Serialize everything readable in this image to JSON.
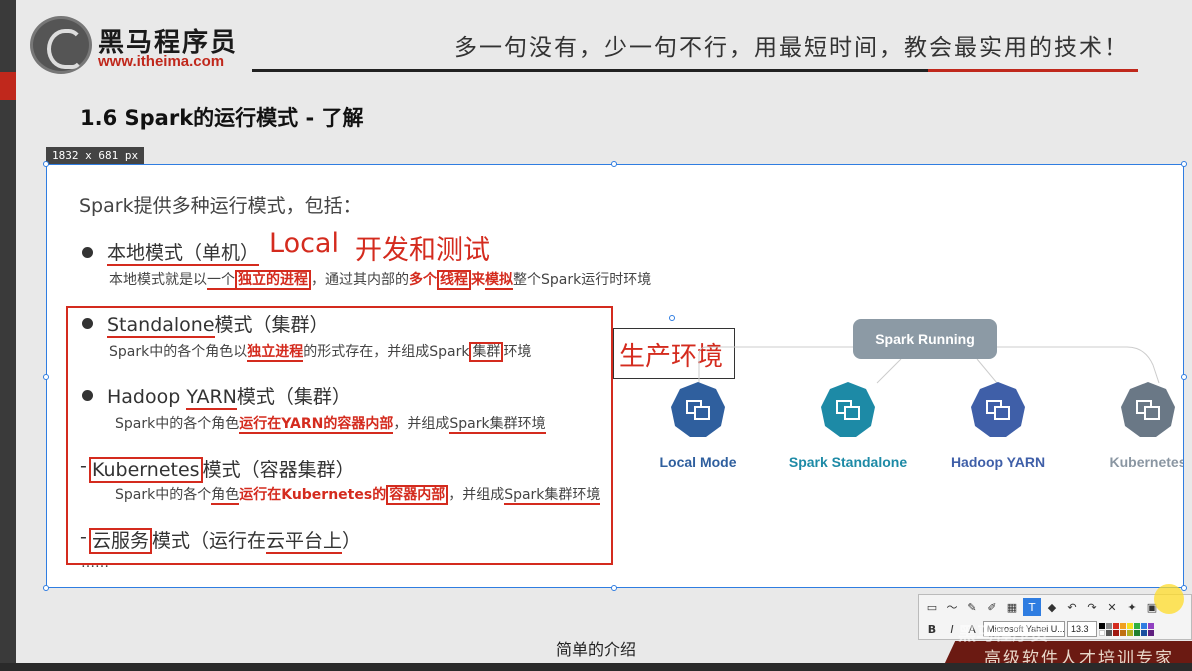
{
  "header": {
    "brand_name": "黑马程序员",
    "brand_url": "www.itheima.com",
    "slogan": "多一句没有，少一句不行，用最短时间，教会最实用的技术！"
  },
  "slide": {
    "title": "1.6 Spark的运行模式 - 了解"
  },
  "screenshot_tool": {
    "dimension_label": "1832 x 681  px",
    "font_name": "Microsoft Yahei U...",
    "font_size": "13.3"
  },
  "content": {
    "intro": "Spark提供多种运行模式，包括：",
    "local": {
      "title": "本地模式（单机）",
      "annotation_1": "Local",
      "annotation_2": "开发和测试",
      "desc_parts": [
        "本地模式就是以",
        "一个",
        "独立的进程",
        "，通过其内部的",
        "多个",
        "线程",
        "来",
        "模拟",
        "整个Spark运行时环境"
      ]
    },
    "standalone": {
      "title_en": "Standalone",
      "title_cn": "模式（集群）",
      "desc_parts": [
        "Spark中的各个角色以",
        "独立进程",
        "的形式存在，并组成Spark",
        "集群",
        "环境"
      ]
    },
    "yarn": {
      "title_pre": "Hadoop ",
      "title_en": "YARN",
      "title_cn": "模式（集群）",
      "desc_parts": [
        "Spark中的各个角色",
        "运行在YARN的容器内部",
        "，并组成",
        "Spark集群环境"
      ]
    },
    "k8s": {
      "dash": "-",
      "title_en": "Kubernetes",
      "title_cn": "模式（容器集群）",
      "desc_parts": [
        "Spark中的各个",
        "角色",
        "运行在Kubernetes的",
        "容器内部",
        "，并组成",
        "Spark集群环境"
      ]
    },
    "cloud": {
      "dash": "-",
      "title_box": "云服务",
      "title_mid": "模式（运行在",
      "title_ul": "云平台上",
      "title_end": "）"
    },
    "ellipsis": "……",
    "production_label": "生产环境"
  },
  "diagram": {
    "root": "Spark Running",
    "nodes": [
      {
        "label": "Local Mode",
        "color": "#2f5f9e"
      },
      {
        "label": "Spark Standalone",
        "color": "#1d8aa6"
      },
      {
        "label": "Hadoop YARN",
        "color": "#3f5fa8"
      },
      {
        "label": "Kubernetes",
        "color": "#6a7886"
      }
    ]
  },
  "video": {
    "subtitle": "简单的介绍",
    "footer": "高级软件人才培训专家",
    "watermark": "黑马程序员"
  }
}
